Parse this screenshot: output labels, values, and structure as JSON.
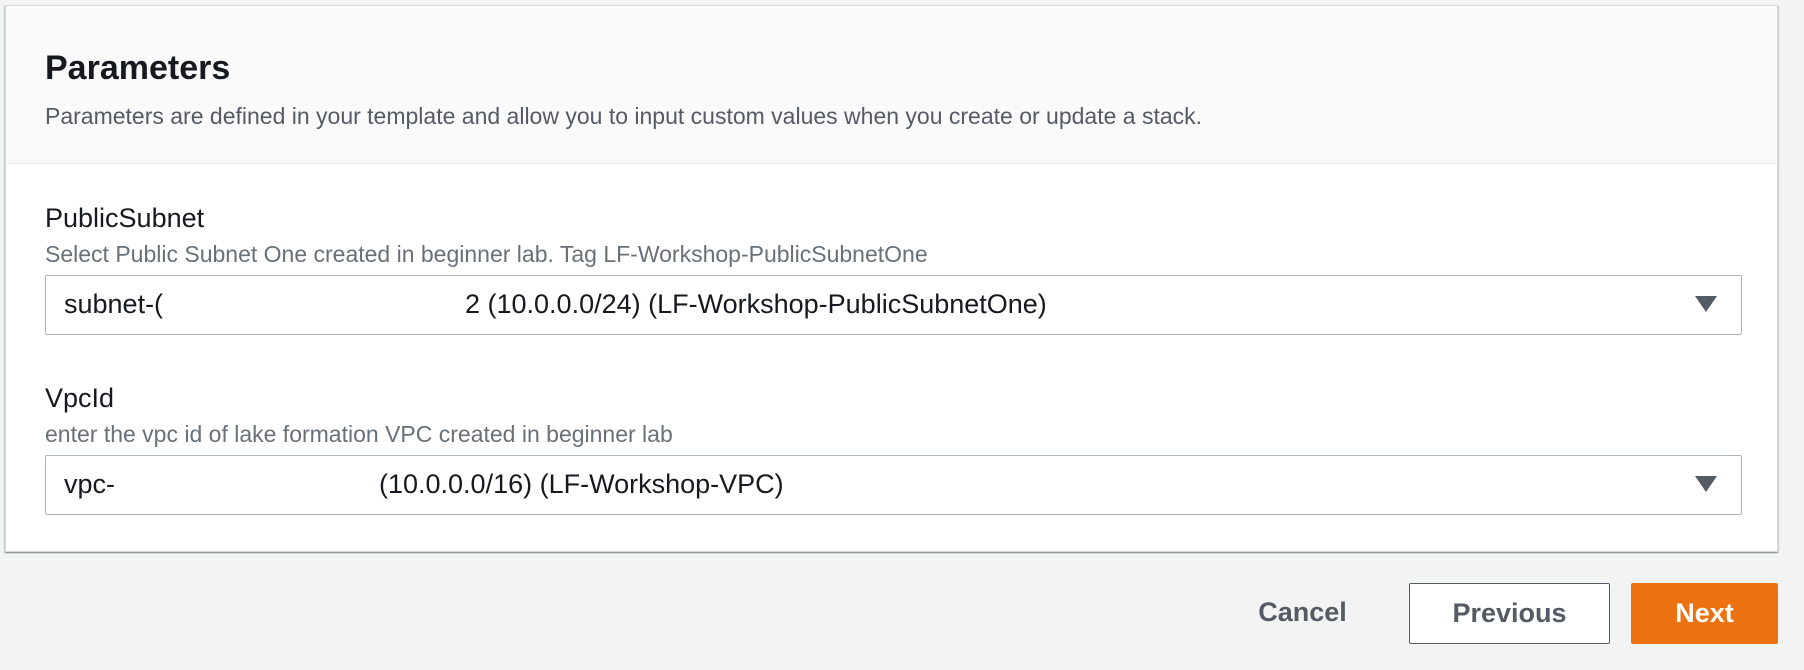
{
  "section": {
    "title": "Parameters",
    "description": "Parameters are defined in your template and allow you to input custom values when you create or update a stack."
  },
  "params": [
    {
      "label": "PublicSubnet",
      "description": "Select Public Subnet One created in beginner lab. Tag LF-Workshop-PublicSubnetOne",
      "value_prefix": "subnet-(",
      "value_suffix": "2 (10.0.0.0/24) (LF-Workshop-PublicSubnetOne)"
    },
    {
      "label": "VpcId",
      "description": "enter the vpc id of lake formation VPC created in beginner lab",
      "value_prefix": "vpc-",
      "value_suffix": "(10.0.0.0/16) (LF-Workshop-VPC)"
    }
  ],
  "footer": {
    "cancel_label": "Cancel",
    "previous_label": "Previous",
    "next_label": "Next"
  },
  "colors": {
    "primary_button": "#ec7211",
    "page_background": "#f2f3f3",
    "secondary_text": "#545b64"
  },
  "icons": {
    "dropdown": "caret-down-icon"
  }
}
